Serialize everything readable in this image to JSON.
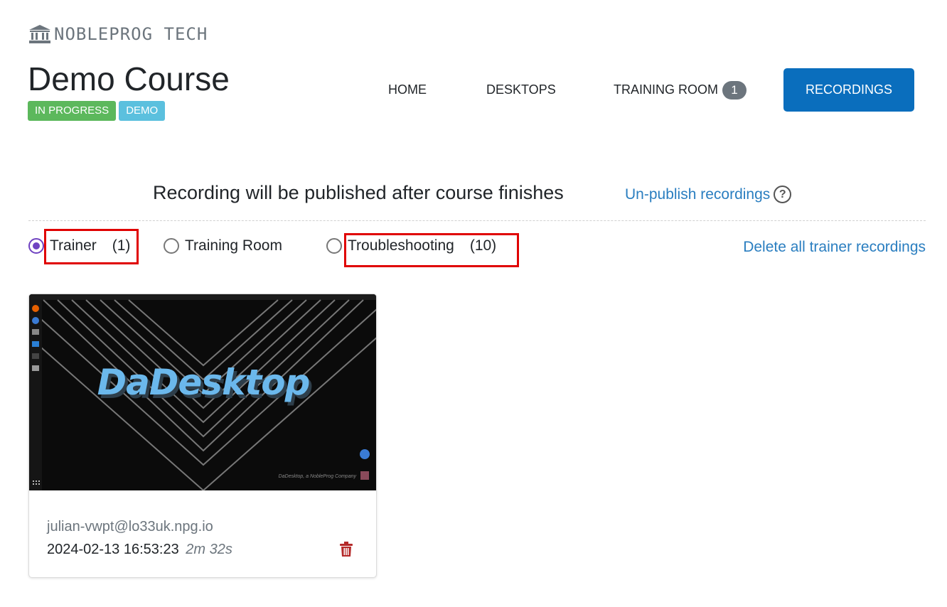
{
  "brand": {
    "name": "NOBLEPROG TECH",
    "icon": "bank-icon"
  },
  "course": {
    "title": "Demo Course",
    "badges": [
      {
        "label": "IN PROGRESS",
        "color": "#5cb85c"
      },
      {
        "label": "DEMO",
        "color": "#5bc0de"
      }
    ]
  },
  "nav": {
    "home": "HOME",
    "desktops": "DESKTOPS",
    "training_room": "TRAINING ROOM",
    "training_room_count": "1",
    "recordings": "RECORDINGS",
    "active": "RECORDINGS",
    "active_color": "#0a6ebd"
  },
  "publish": {
    "status_text": "Recording will be published after course finishes",
    "unpublish_link": "Un-publish recordings",
    "help_icon": "question-circle-icon"
  },
  "filters": {
    "options": [
      {
        "label": "Trainer",
        "count": "(1)",
        "selected": true
      },
      {
        "label": "Training Room",
        "count": "",
        "selected": false
      },
      {
        "label": "Troubleshooting",
        "count": "(10)",
        "selected": false
      }
    ],
    "delete_all": "Delete all trainer recordings"
  },
  "recordings": [
    {
      "thumbnail_text": "DaDesktop",
      "thumbnail_footer": "DaDesktop, a NobleProg Company",
      "user": "julian-vwpt@lo33uk.npg.io",
      "datetime": "2024-02-13 16:53:23",
      "duration": "2m 32s",
      "delete_icon": "trash-icon"
    }
  ]
}
